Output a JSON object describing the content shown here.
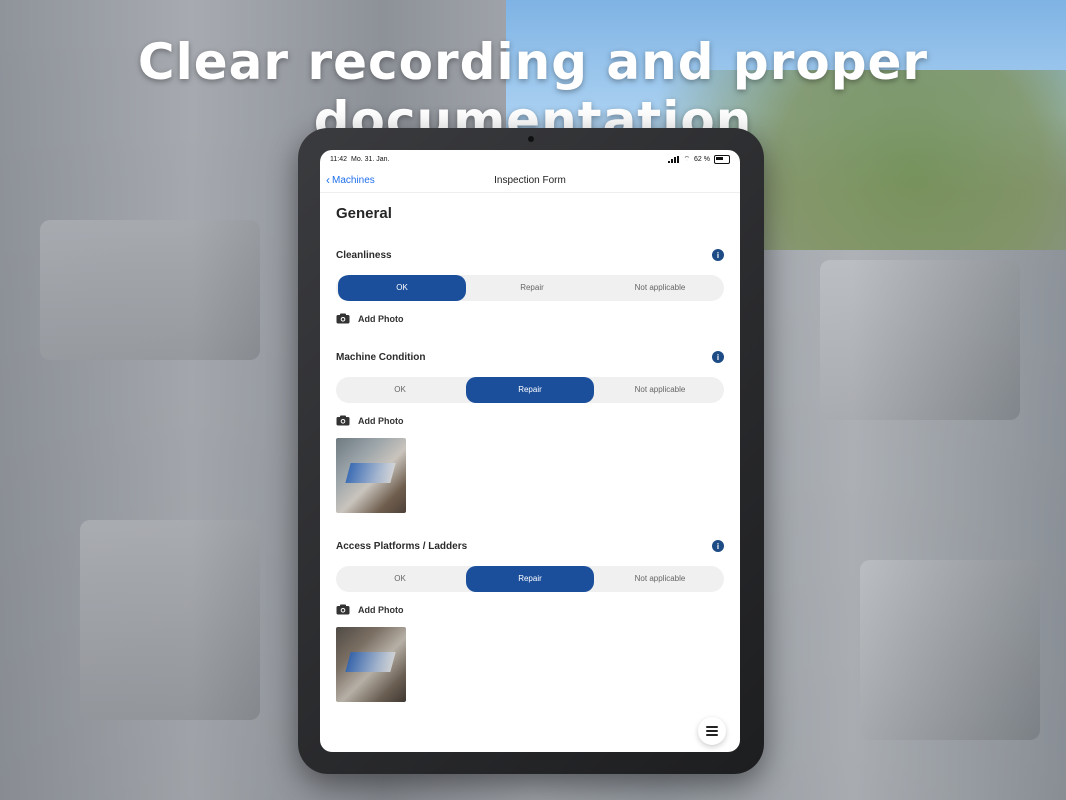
{
  "headline": "Clear recording and proper documentation",
  "status_bar": {
    "time": "11:42",
    "date": "Mo. 31. Jan.",
    "battery": "62 %"
  },
  "nav": {
    "back_label": "Machines",
    "title": "Inspection Form"
  },
  "page": {
    "heading": "General",
    "sections": [
      {
        "label": "Cleanliness",
        "options": [
          "OK",
          "Repair",
          "Not applicable"
        ],
        "selected": "OK",
        "add_photo": "Add Photo",
        "has_photo": false
      },
      {
        "label": "Machine Condition",
        "options": [
          "OK",
          "Repair",
          "Not applicable"
        ],
        "selected": "Repair",
        "add_photo": "Add Photo",
        "has_photo": true
      },
      {
        "label": "Access Platforms / Ladders",
        "options": [
          "OK",
          "Repair",
          "Not applicable"
        ],
        "selected": "Repair",
        "add_photo": "Add Photo",
        "has_photo": true
      }
    ]
  },
  "icons": {
    "back": "chevron-left-icon",
    "info": "info-icon",
    "camera": "camera-icon",
    "menu": "hamburger-menu-icon"
  },
  "colors": {
    "accent": "#1b4f9c",
    "link": "#1f6feb"
  }
}
